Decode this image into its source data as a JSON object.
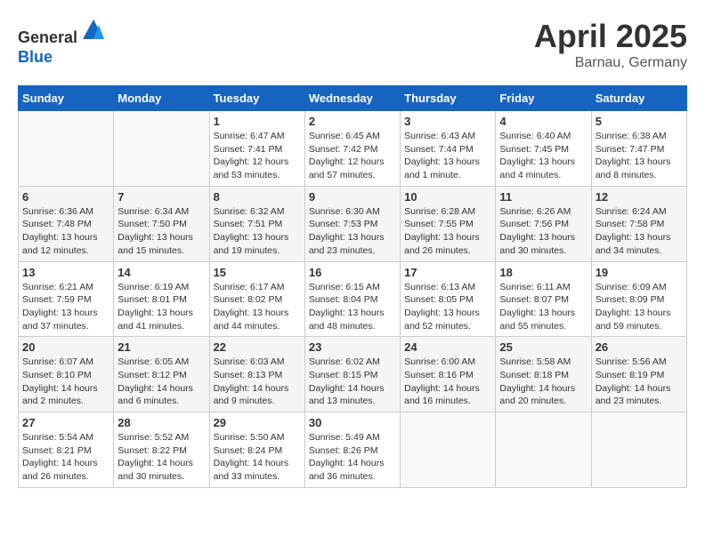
{
  "header": {
    "logo_line1": "General",
    "logo_line2": "Blue",
    "month": "April 2025",
    "location": "Barnau, Germany"
  },
  "weekdays": [
    "Sunday",
    "Monday",
    "Tuesday",
    "Wednesday",
    "Thursday",
    "Friday",
    "Saturday"
  ],
  "weeks": [
    [
      {
        "day": "",
        "info": ""
      },
      {
        "day": "",
        "info": ""
      },
      {
        "day": "1",
        "info": "Sunrise: 6:47 AM\nSunset: 7:41 PM\nDaylight: 12 hours and 53 minutes."
      },
      {
        "day": "2",
        "info": "Sunrise: 6:45 AM\nSunset: 7:42 PM\nDaylight: 12 hours and 57 minutes."
      },
      {
        "day": "3",
        "info": "Sunrise: 6:43 AM\nSunset: 7:44 PM\nDaylight: 13 hours and 1 minute."
      },
      {
        "day": "4",
        "info": "Sunrise: 6:40 AM\nSunset: 7:45 PM\nDaylight: 13 hours and 4 minutes."
      },
      {
        "day": "5",
        "info": "Sunrise: 6:38 AM\nSunset: 7:47 PM\nDaylight: 13 hours and 8 minutes."
      }
    ],
    [
      {
        "day": "6",
        "info": "Sunrise: 6:36 AM\nSunset: 7:48 PM\nDaylight: 13 hours and 12 minutes."
      },
      {
        "day": "7",
        "info": "Sunrise: 6:34 AM\nSunset: 7:50 PM\nDaylight: 13 hours and 15 minutes."
      },
      {
        "day": "8",
        "info": "Sunrise: 6:32 AM\nSunset: 7:51 PM\nDaylight: 13 hours and 19 minutes."
      },
      {
        "day": "9",
        "info": "Sunrise: 6:30 AM\nSunset: 7:53 PM\nDaylight: 13 hours and 23 minutes."
      },
      {
        "day": "10",
        "info": "Sunrise: 6:28 AM\nSunset: 7:55 PM\nDaylight: 13 hours and 26 minutes."
      },
      {
        "day": "11",
        "info": "Sunrise: 6:26 AM\nSunset: 7:56 PM\nDaylight: 13 hours and 30 minutes."
      },
      {
        "day": "12",
        "info": "Sunrise: 6:24 AM\nSunset: 7:58 PM\nDaylight: 13 hours and 34 minutes."
      }
    ],
    [
      {
        "day": "13",
        "info": "Sunrise: 6:21 AM\nSunset: 7:59 PM\nDaylight: 13 hours and 37 minutes."
      },
      {
        "day": "14",
        "info": "Sunrise: 6:19 AM\nSunset: 8:01 PM\nDaylight: 13 hours and 41 minutes."
      },
      {
        "day": "15",
        "info": "Sunrise: 6:17 AM\nSunset: 8:02 PM\nDaylight: 13 hours and 44 minutes."
      },
      {
        "day": "16",
        "info": "Sunrise: 6:15 AM\nSunset: 8:04 PM\nDaylight: 13 hours and 48 minutes."
      },
      {
        "day": "17",
        "info": "Sunrise: 6:13 AM\nSunset: 8:05 PM\nDaylight: 13 hours and 52 minutes."
      },
      {
        "day": "18",
        "info": "Sunrise: 6:11 AM\nSunset: 8:07 PM\nDaylight: 13 hours and 55 minutes."
      },
      {
        "day": "19",
        "info": "Sunrise: 6:09 AM\nSunset: 8:09 PM\nDaylight: 13 hours and 59 minutes."
      }
    ],
    [
      {
        "day": "20",
        "info": "Sunrise: 6:07 AM\nSunset: 8:10 PM\nDaylight: 14 hours and 2 minutes."
      },
      {
        "day": "21",
        "info": "Sunrise: 6:05 AM\nSunset: 8:12 PM\nDaylight: 14 hours and 6 minutes."
      },
      {
        "day": "22",
        "info": "Sunrise: 6:03 AM\nSunset: 8:13 PM\nDaylight: 14 hours and 9 minutes."
      },
      {
        "day": "23",
        "info": "Sunrise: 6:02 AM\nSunset: 8:15 PM\nDaylight: 14 hours and 13 minutes."
      },
      {
        "day": "24",
        "info": "Sunrise: 6:00 AM\nSunset: 8:16 PM\nDaylight: 14 hours and 16 minutes."
      },
      {
        "day": "25",
        "info": "Sunrise: 5:58 AM\nSunset: 8:18 PM\nDaylight: 14 hours and 20 minutes."
      },
      {
        "day": "26",
        "info": "Sunrise: 5:56 AM\nSunset: 8:19 PM\nDaylight: 14 hours and 23 minutes."
      }
    ],
    [
      {
        "day": "27",
        "info": "Sunrise: 5:54 AM\nSunset: 8:21 PM\nDaylight: 14 hours and 26 minutes."
      },
      {
        "day": "28",
        "info": "Sunrise: 5:52 AM\nSunset: 8:22 PM\nDaylight: 14 hours and 30 minutes."
      },
      {
        "day": "29",
        "info": "Sunrise: 5:50 AM\nSunset: 8:24 PM\nDaylight: 14 hours and 33 minutes."
      },
      {
        "day": "30",
        "info": "Sunrise: 5:49 AM\nSunset: 8:26 PM\nDaylight: 14 hours and 36 minutes."
      },
      {
        "day": "",
        "info": ""
      },
      {
        "day": "",
        "info": ""
      },
      {
        "day": "",
        "info": ""
      }
    ]
  ]
}
